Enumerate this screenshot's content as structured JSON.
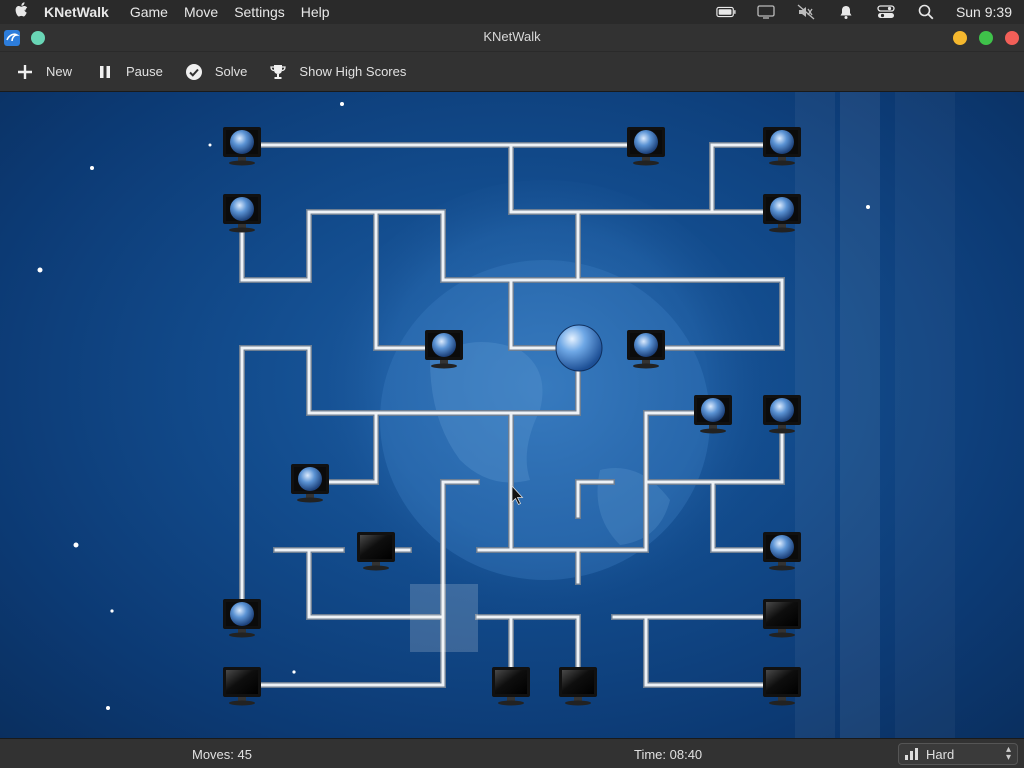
{
  "menubar": {
    "app_name": "KNetWalk",
    "menus": [
      "Game",
      "Move",
      "Settings",
      "Help"
    ],
    "clock": "Sun 9:39"
  },
  "window": {
    "title": "KNetWalk"
  },
  "toolbar": {
    "new_label": "New",
    "pause_label": "Pause",
    "solve_label": "Solve",
    "highscores_label": "Show High Scores"
  },
  "status": {
    "moves": "Moves: 45",
    "time": "Time: 08:40",
    "difficulty": "Hard"
  },
  "colors": {
    "board_blue": "#124b8c",
    "pipe": "#e6e6e6",
    "traffic_yellow": "#f5b82e",
    "traffic_green": "#3fc24a",
    "traffic_red": "#f25f58"
  }
}
